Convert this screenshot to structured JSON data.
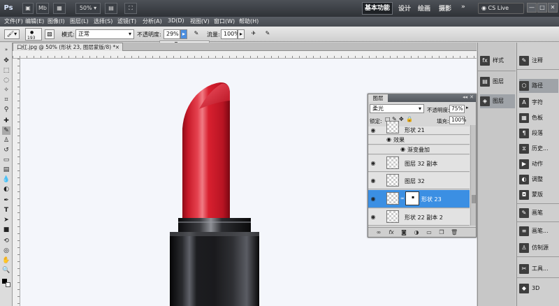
{
  "app": {
    "logo": "Ps",
    "zoom": "50%",
    "workspaces": [
      "基本功能",
      "设计",
      "绘画",
      "摄影"
    ],
    "more": "»",
    "cs_live": "CS Live",
    "win_buttons": [
      "—",
      "□",
      "✕"
    ]
  },
  "menu": [
    "文件(F)",
    "编辑(E)",
    "图像(I)",
    "图层(L)",
    "选择(S)",
    "滤镜(T)",
    "分析(A)",
    "3D(D)",
    "视图(V)",
    "窗口(W)",
    "帮助(H)"
  ],
  "options": {
    "brush_size": "193",
    "mode_label": "模式:",
    "mode_value": "正常",
    "opacity_label": "不透明度:",
    "opacity_value": "29%",
    "flow_label": "流量:",
    "flow_value": "100%",
    "slider_level": 0.29
  },
  "document": {
    "tab_title": "口红.jpg @ 50% (形状 23, 图层蒙版/8) *"
  },
  "layers_panel": {
    "tab": "图层",
    "blend_mode": "柔光",
    "opacity_label": "不透明度:",
    "opacity_value": "75%",
    "lock_label": "锁定:",
    "fill_label": "填充:",
    "fill_value": "100%",
    "layers": [
      {
        "name": "形状 21",
        "type": "layer"
      },
      {
        "name": "效果",
        "type": "effects"
      },
      {
        "name": "渐变叠加",
        "type": "effect"
      },
      {
        "name": "图层 32 副本",
        "type": "layer"
      },
      {
        "name": "图层 32",
        "type": "layer"
      },
      {
        "name": "形状 23",
        "type": "layer",
        "selected": true
      },
      {
        "name": "形状 22 副本 2",
        "type": "layer"
      }
    ]
  },
  "dock1": [
    "样式",
    "图层",
    "图层"
  ],
  "dock2": [
    "注释",
    "路径",
    "字符",
    "色板",
    "段落",
    "历史...",
    "动作",
    "调整",
    "蒙版",
    "画笔",
    "画笔...",
    "仿制源",
    "工具...",
    "3D"
  ],
  "colors": {
    "selection": "#3b8fe3",
    "lipstick_red": "#d8202f",
    "case_black": "#1a1a1d"
  }
}
